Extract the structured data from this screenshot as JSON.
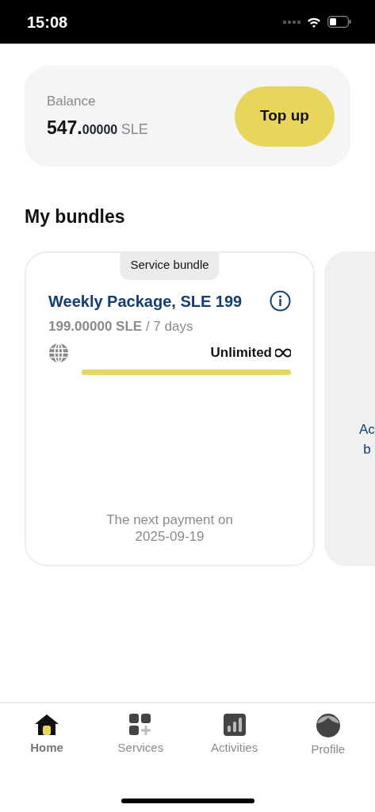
{
  "status_bar": {
    "time": "15:08"
  },
  "balance": {
    "label": "Balance",
    "amount_whole": "547.",
    "amount_fraction": "00000",
    "currency": "SLE",
    "button": "Top up"
  },
  "section_title": "My bundles",
  "bundles": [
    {
      "tag": "Service bundle",
      "title": "Weekly Package, SLE 199",
      "price": "199.00000 SLE",
      "period": "/ 7 days",
      "allowance": "Unlimited",
      "level": 1,
      "next_payment": "The next payment on",
      "next_date": "2025-09-19"
    }
  ],
  "add_card": {
    "lines": [
      "Ac",
      "b"
    ]
  },
  "nav": [
    {
      "label": "Home",
      "kind": "home",
      "selected": true
    },
    {
      "label": "Services",
      "kind": "services",
      "selected": false
    },
    {
      "label": "Activities",
      "kind": "activities",
      "selected": false
    },
    {
      "label": "Profile",
      "kind": "profile",
      "selected": false
    }
  ]
}
